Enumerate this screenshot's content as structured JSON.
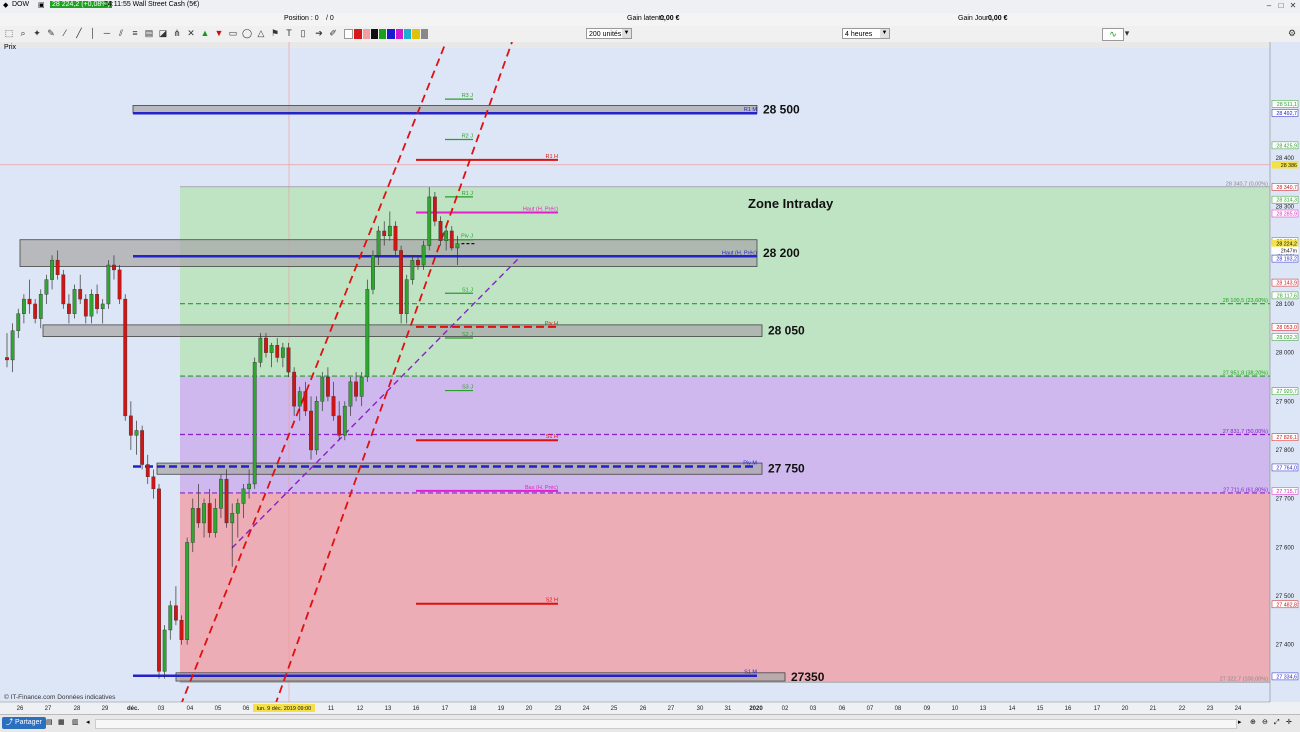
{
  "window": {
    "symbol": "DOW",
    "quote": "28 224,2 (+0,08%)",
    "time_name": "14:11:55 Wall Street Cash (5€)"
  },
  "info": {
    "position": "Position : 0",
    "position_pending": "/ 0",
    "gain_latent": "Gain latent :",
    "gain_latent_value": "0,00 €",
    "gain_jour": "Gain Jour :",
    "gain_jour_value": "0,00 €"
  },
  "toolbar": {
    "units_value": "200 unités",
    "timeframe_value": "4 heures"
  },
  "chart_title": "Prix",
  "copyright": "© IT-Finance.com Données indicatives",
  "share_label": "Partager",
  "colors": {
    "up": "#2fa62f",
    "down": "#d01515",
    "green_zone": "#bfe4c4",
    "purple_zone": "#cfb8ee",
    "red_zone": "#ecadb6",
    "gray_box": "#a9a9a9",
    "blue_line": "#2323c8",
    "accent_red": "#e01010",
    "magenta": "#e020c8"
  },
  "chart_data": {
    "type": "candlestick",
    "ylim": [
      27282,
      28626
    ],
    "xaxis_labels": [
      "26",
      "27",
      "28",
      "29",
      "déc.",
      "03",
      "04",
      "05",
      "06",
      "09",
      "10",
      "11",
      "12",
      "13",
      "16",
      "17",
      "18",
      "19",
      "20",
      "23",
      "24",
      "25",
      "26",
      "27",
      "30",
      "31",
      "2020",
      "02",
      "03",
      "06",
      "07",
      "08",
      "09",
      "10",
      "13",
      "14",
      "15",
      "16",
      "17",
      "20",
      "21",
      "22",
      "23",
      "24"
    ],
    "cursor_x_label": "lun. 9 déc. 2019 09:00",
    "yaxis_ticks": [
      "28 400",
      "28 300",
      "28 200",
      "28 100",
      "28 000",
      "27 900",
      "27 800",
      "27 700",
      "27 600",
      "27 500",
      "27 400"
    ],
    "yaxis_tags": [
      {
        "text": "28 511,1",
        "value": 28511.1,
        "color": "#2a9d2a"
      },
      {
        "text": "28 492,7",
        "value": 28492.7,
        "color": "#2323c8"
      },
      {
        "text": "28 425,9",
        "value": 28425.9,
        "color": "#2a9d2a"
      },
      {
        "text": "28 386",
        "value": 28386,
        "color": "#f4e14a"
      },
      {
        "text": "28 340,7",
        "value": 28340.7,
        "color": "#d01515"
      },
      {
        "text": "28 314,3",
        "value": 28314.3,
        "color": "#2a9d2a"
      },
      {
        "text": "28 285,9",
        "value": 28285.9,
        "color": "#e020c8"
      },
      {
        "text": "28 229,1",
        "value": 28229.1,
        "color": "#2a9d2a"
      },
      {
        "text": "28 224,2",
        "value": 28224.2,
        "color": "#f4e14a"
      },
      {
        "text": "2h47m",
        "value": 28210,
        "color": "#ffffff"
      },
      {
        "text": "28 193,2",
        "value": 28193.2,
        "color": "#2323c8"
      },
      {
        "text": "28 143,9",
        "value": 28143.9,
        "color": "#d01515"
      },
      {
        "text": "28 117,6",
        "value": 28117.6,
        "color": "#2a9d2a"
      },
      {
        "text": "28 053,0",
        "value": 28053,
        "color": "#d01515"
      },
      {
        "text": "28 032,3",
        "value": 28032.3,
        "color": "#2a9d2a"
      },
      {
        "text": "27 920,7",
        "value": 27920.7,
        "color": "#2a9d2a"
      },
      {
        "text": "27 826,1",
        "value": 27826.1,
        "color": "#d01515"
      },
      {
        "text": "27 764,0",
        "value": 27764,
        "color": "#2323c8"
      },
      {
        "text": "27 715,7",
        "value": 27715.7,
        "color": "#e020c8"
      },
      {
        "text": "27 482,8",
        "value": 27482.8,
        "color": "#d01515"
      },
      {
        "text": "27 334,6",
        "value": 27334.6,
        "color": "#2323c8"
      }
    ],
    "fib_levels": [
      {
        "label": "28 340,7 (0,00%)",
        "value": 28340.7
      },
      {
        "label": "28 100,5 (23,60%)",
        "value": 28100.5
      },
      {
        "label": "27 951,8 (38,20%)",
        "value": 27951.8
      },
      {
        "label": "27 831,7 (50,00%)",
        "value": 27831.7
      },
      {
        "label": "27 711,6 (61,80%)",
        "value": 27711.6
      },
      {
        "label": "27 322,7 (100,00%)",
        "value": 27322.7
      }
    ],
    "zones": [
      {
        "label": "28 500",
        "top": 28508,
        "bottom": 28492
      },
      {
        "label": "28 200",
        "top": 28232,
        "bottom": 28177
      },
      {
        "label": "28 050",
        "top": 28057,
        "bottom": 28033
      },
      {
        "label": "27 750",
        "top": 27773,
        "bottom": 27750
      },
      {
        "label": "27350",
        "top": 27342,
        "bottom": 27325
      }
    ],
    "annotation": "Zone Intraday",
    "pivots": [
      {
        "label": "R3 J",
        "value": 28521,
        "color": "#2a9d2a"
      },
      {
        "label": "R2 J",
        "value": 28438,
        "color": "#2a9d2a"
      },
      {
        "label": "R1 J",
        "value": 28320,
        "color": "#2a9d2a"
      },
      {
        "label": "Piv J",
        "value": 28232,
        "color": "#2a9d2a"
      },
      {
        "label": "S1 J",
        "value": 28122,
        "color": "#2a9d2a"
      },
      {
        "label": "S2 J",
        "value": 28030,
        "color": "#2a9d2a"
      },
      {
        "label": "S3 J",
        "value": 27922,
        "color": "#2a9d2a"
      },
      {
        "label": "R1 H",
        "value": 28396,
        "color": "#e01010"
      },
      {
        "label": "Piv H",
        "value": 28053,
        "color": "#e01010"
      },
      {
        "label": "S1 H",
        "value": 27820,
        "color": "#e01010"
      },
      {
        "label": "S2 H",
        "value": 27484,
        "color": "#e01010"
      },
      {
        "label": "S3 H",
        "value": 27250,
        "color": "#e01010"
      },
      {
        "label": "Haut (H. Préc)",
        "value": 28288,
        "color": "#e020c8"
      },
      {
        "label": "Bas (H. Préc)",
        "value": 27716,
        "color": "#e020c8"
      },
      {
        "label": "Haut (H. Préc)",
        "value": 28198,
        "color": "#2323c8"
      },
      {
        "label": "R1 M",
        "value": 28492,
        "color": "#2323c8"
      },
      {
        "label": "Piv M",
        "value": 27766,
        "color": "#2323c8"
      },
      {
        "label": "S1 M",
        "value": 27336,
        "color": "#2323c8"
      }
    ],
    "candles": [
      [
        27990,
        28040,
        27970,
        27985
      ],
      [
        27985,
        28060,
        27960,
        28045
      ],
      [
        28045,
        28090,
        28030,
        28080
      ],
      [
        28080,
        28120,
        28060,
        28110
      ],
      [
        28110,
        28150,
        28080,
        28100
      ],
      [
        28100,
        28110,
        28060,
        28070
      ],
      [
        28070,
        28130,
        28050,
        28120
      ],
      [
        28120,
        28160,
        28100,
        28150
      ],
      [
        28150,
        28200,
        28130,
        28190
      ],
      [
        28190,
        28210,
        28150,
        28160
      ],
      [
        28160,
        28170,
        28090,
        28100
      ],
      [
        28100,
        28120,
        28060,
        28080
      ],
      [
        28080,
        28140,
        28070,
        28130
      ],
      [
        28130,
        28160,
        28100,
        28110
      ],
      [
        28110,
        28120,
        28060,
        28075
      ],
      [
        28075,
        28130,
        28060,
        28120
      ],
      [
        28120,
        28140,
        28080,
        28090
      ],
      [
        28090,
        28110,
        28060,
        28100
      ],
      [
        28100,
        28190,
        28090,
        28180
      ],
      [
        28180,
        28200,
        28150,
        28170
      ],
      [
        28170,
        28180,
        28100,
        28110
      ],
      [
        28110,
        28120,
        27860,
        27870
      ],
      [
        27870,
        27900,
        27800,
        27830
      ],
      [
        27830,
        27860,
        27790,
        27840
      ],
      [
        27840,
        27850,
        27760,
        27770
      ],
      [
        27770,
        27790,
        27730,
        27745
      ],
      [
        27745,
        27760,
        27700,
        27720
      ],
      [
        27720,
        27730,
        27330,
        27345
      ],
      [
        27345,
        27440,
        27330,
        27430
      ],
      [
        27430,
        27490,
        27410,
        27480
      ],
      [
        27480,
        27520,
        27440,
        27450
      ],
      [
        27450,
        27460,
        27400,
        27410
      ],
      [
        27410,
        27620,
        27400,
        27610
      ],
      [
        27610,
        27700,
        27590,
        27680
      ],
      [
        27680,
        27730,
        27640,
        27650
      ],
      [
        27650,
        27700,
        27620,
        27690
      ],
      [
        27690,
        27720,
        27620,
        27630
      ],
      [
        27630,
        27700,
        27620,
        27680
      ],
      [
        27680,
        27750,
        27660,
        27740
      ],
      [
        27740,
        27760,
        27640,
        27650
      ],
      [
        27650,
        27690,
        27560,
        27670
      ],
      [
        27670,
        27700,
        27620,
        27690
      ],
      [
        27690,
        27730,
        27660,
        27720
      ],
      [
        27720,
        27760,
        27700,
        27730
      ],
      [
        27730,
        27990,
        27720,
        27980
      ],
      [
        27980,
        28040,
        27970,
        28030
      ],
      [
        28030,
        28040,
        27990,
        28000
      ],
      [
        28000,
        28020,
        27970,
        28015
      ],
      [
        28015,
        28030,
        27980,
        27990
      ],
      [
        27990,
        28020,
        27970,
        28010
      ],
      [
        28010,
        28020,
        27950,
        27960
      ],
      [
        27960,
        27970,
        27870,
        27890
      ],
      [
        27890,
        27930,
        27860,
        27920
      ],
      [
        27920,
        27940,
        27870,
        27880
      ],
      [
        27880,
        27910,
        27780,
        27800
      ],
      [
        27800,
        27910,
        27790,
        27900
      ],
      [
        27900,
        27960,
        27880,
        27950
      ],
      [
        27950,
        27970,
        27900,
        27910
      ],
      [
        27910,
        27940,
        27860,
        27870
      ],
      [
        27870,
        27900,
        27820,
        27830
      ],
      [
        27830,
        27900,
        27820,
        27890
      ],
      [
        27890,
        27950,
        27870,
        27940
      ],
      [
        27940,
        27960,
        27900,
        27910
      ],
      [
        27910,
        27960,
        27890,
        27950
      ],
      [
        27950,
        28150,
        27940,
        28130
      ],
      [
        28130,
        28210,
        28120,
        28200
      ],
      [
        28200,
        28260,
        28180,
        28250
      ],
      [
        28250,
        28270,
        28220,
        28240
      ],
      [
        28240,
        28290,
        28230,
        28260
      ],
      [
        28260,
        28270,
        28200,
        28210
      ],
      [
        28210,
        28220,
        28060,
        28080
      ],
      [
        28080,
        28160,
        28060,
        28150
      ],
      [
        28150,
        28200,
        28140,
        28190
      ],
      [
        28190,
        28200,
        28170,
        28180
      ],
      [
        28180,
        28230,
        28170,
        28220
      ],
      [
        28220,
        28340,
        28210,
        28320
      ],
      [
        28320,
        28330,
        28260,
        28270
      ],
      [
        28270,
        28280,
        28220,
        28230
      ],
      [
        28230,
        28260,
        28210,
        28250
      ],
      [
        28250,
        28260,
        28210,
        28215
      ],
      [
        28215,
        28240,
        28180,
        28224
      ]
    ]
  }
}
